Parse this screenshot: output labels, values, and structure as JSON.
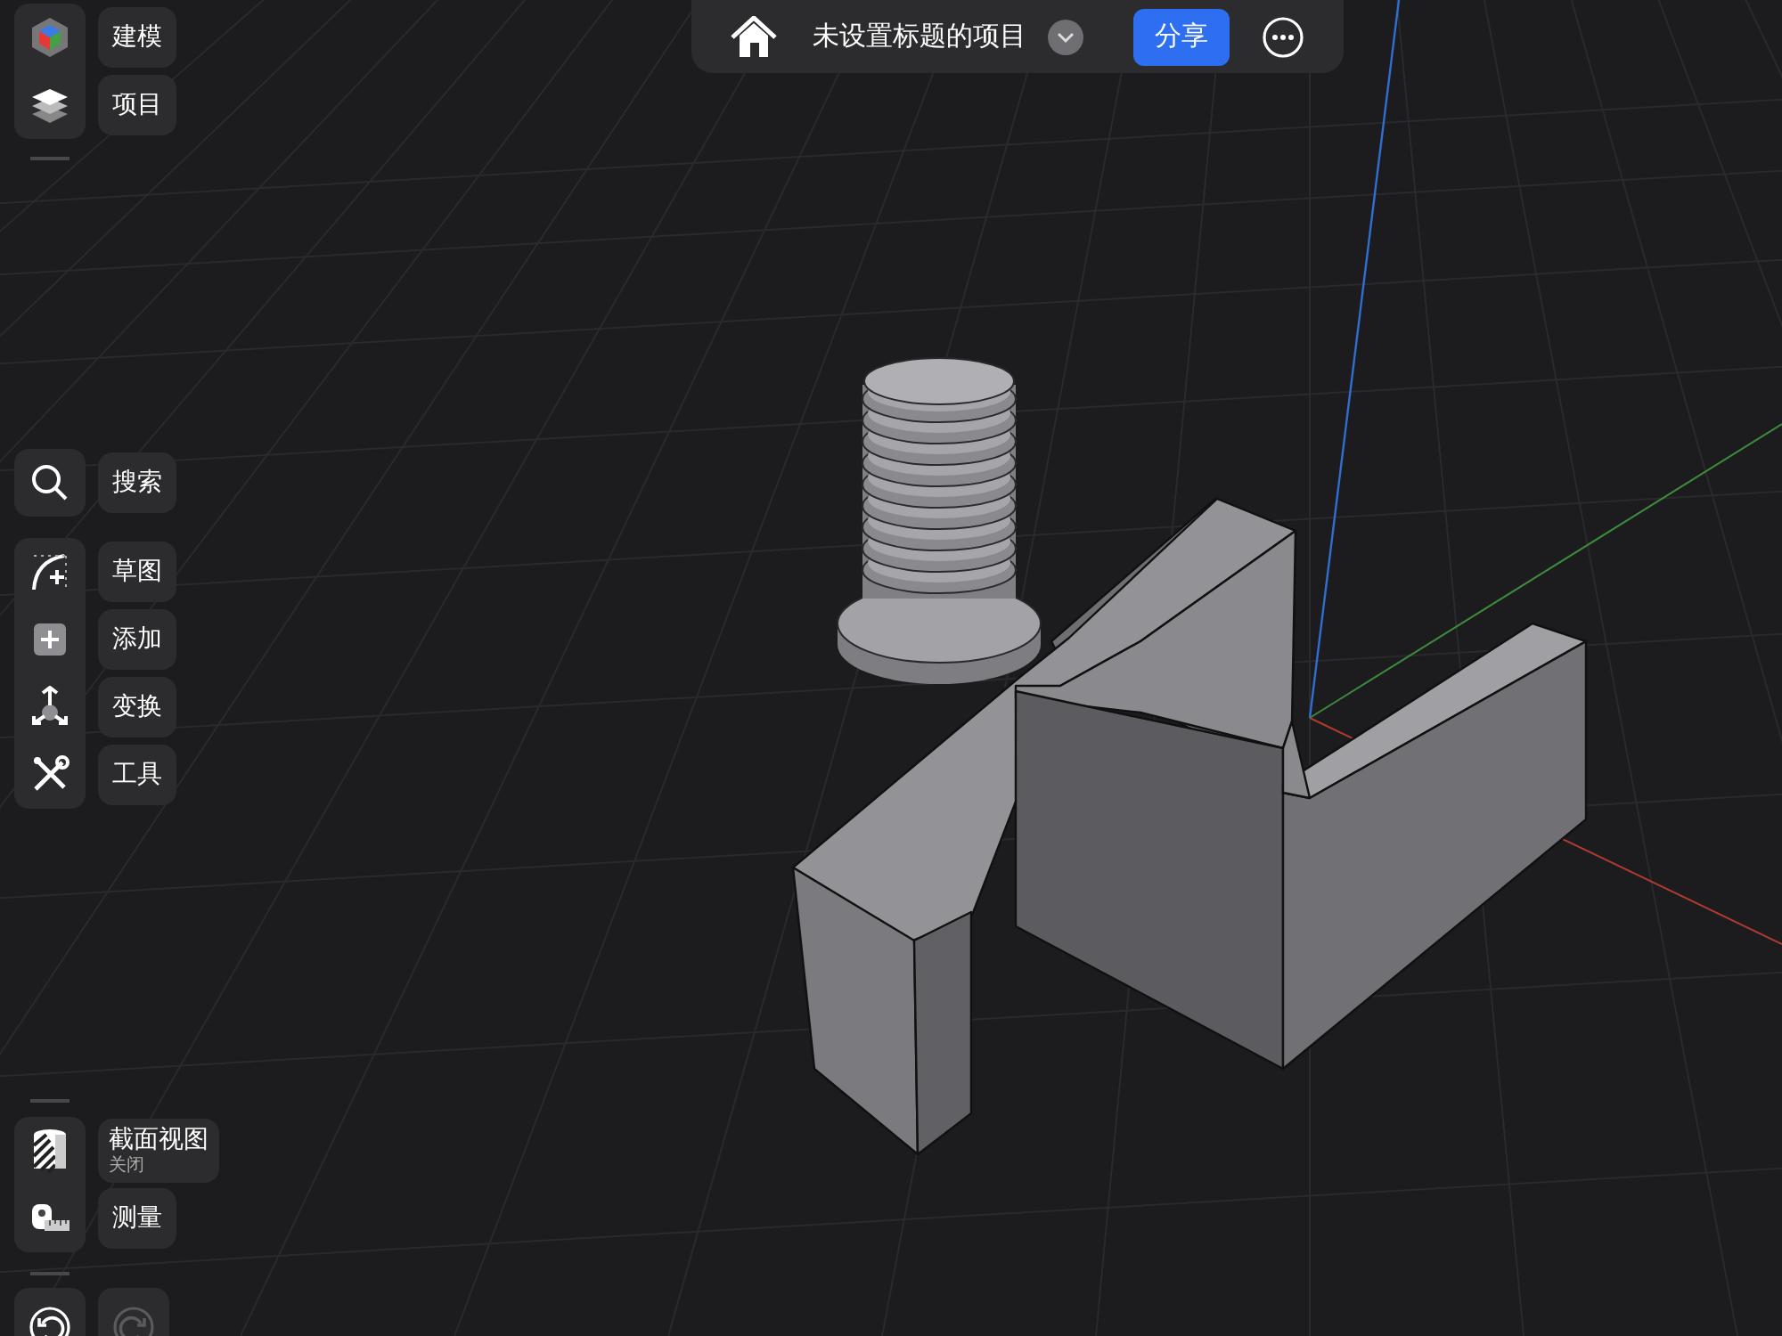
{
  "top_bar": {
    "title": "未设置标题的项目",
    "share_button": "分享"
  },
  "tool_groups": [
    {
      "items": [
        {
          "kind": "cube",
          "label": "建模"
        },
        {
          "kind": "layers",
          "label": "项目"
        }
      ]
    },
    {
      "items": [
        {
          "kind": "search",
          "label": "搜索"
        }
      ]
    },
    {
      "items": [
        {
          "kind": "sketch",
          "label": "草图"
        },
        {
          "kind": "add",
          "label": "添加"
        },
        {
          "kind": "transform",
          "label": "变换"
        },
        {
          "kind": "tools",
          "label": "工具"
        }
      ]
    },
    {
      "items": [
        {
          "kind": "section",
          "label": "截面视图",
          "sublabel": "关闭"
        },
        {
          "kind": "measure",
          "label": "测量"
        }
      ]
    }
  ],
  "history": [
    {
      "kind": "undo",
      "disabled": false
    },
    {
      "kind": "redo",
      "disabled": true
    }
  ]
}
